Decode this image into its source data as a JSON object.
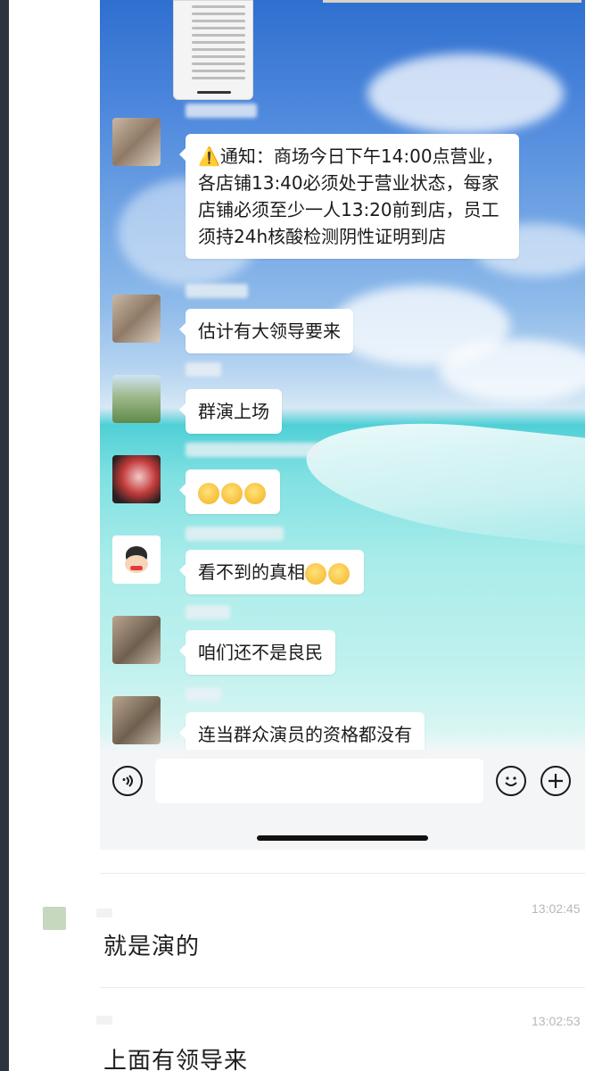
{
  "chat": {
    "messages": [
      {
        "sender_name": "",
        "text": "⚠️通知：商场今日下午14:00点营业，各店铺13:40必须处于营业状态，每家店铺必须至少一人13:20前到店，员工须持24h核酸检测阴性证明到店",
        "warn_icon": "warning-icon"
      },
      {
        "sender_name": "",
        "text": "估计有大领导要来"
      },
      {
        "sender_name": "",
        "text": "群演上场"
      },
      {
        "sender_name": "",
        "text": "",
        "emojis": [
          "facepalm-icon",
          "facepalm-icon",
          "facepalm-icon"
        ]
      },
      {
        "sender_name": "",
        "text": "看不到的真相",
        "emojis": [
          "flushed-icon",
          "flushed-icon"
        ]
      },
      {
        "sender_name": "",
        "text": "咱们还不是良民"
      },
      {
        "sender_name": "",
        "text": "连当群众演员的资格都没有"
      }
    ],
    "input": {
      "value": "",
      "voice_icon": "voice-icon",
      "emoji_icon": "smile-icon",
      "more_icon": "plus-icon"
    }
  },
  "comments": [
    {
      "author": "",
      "time": "13:02:45",
      "text": "就是演的"
    },
    {
      "author": "",
      "time": "13:02:53",
      "text": "上面有领导来"
    }
  ],
  "colors": {
    "warning": "#e8a400",
    "bubble": "#ffffff",
    "timestamp": "#b8b8b8"
  }
}
